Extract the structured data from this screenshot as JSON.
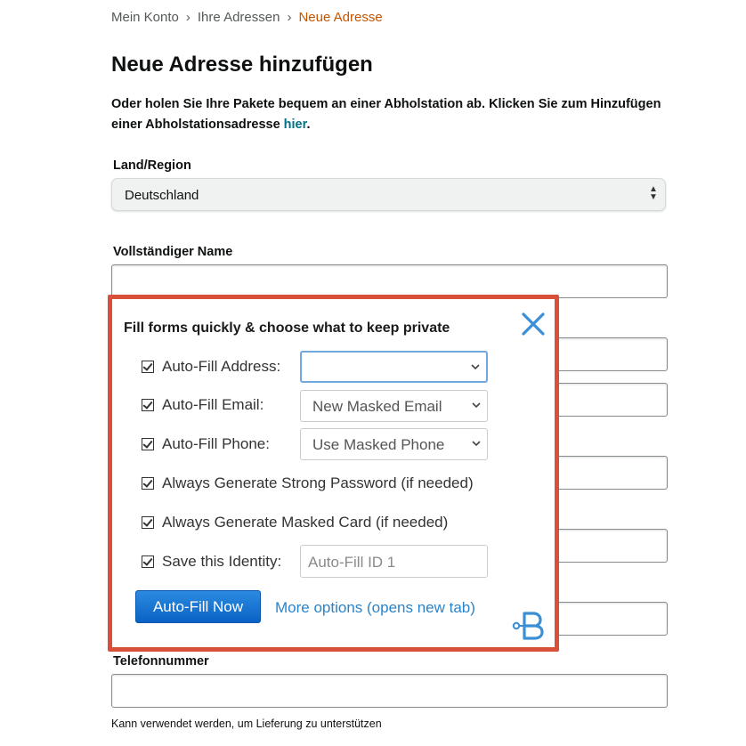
{
  "breadcrumb": {
    "items": [
      "Mein Konto",
      "Ihre Adressen"
    ],
    "current": "Neue Adresse",
    "separator": "›"
  },
  "page": {
    "title": "Neue Adresse hinzufügen",
    "intro_text": "Oder holen Sie Ihre Pakete bequem an einer Abholstation ab. Klicken Sie zum Hinzufügen einer Abholstationsadresse ",
    "intro_link": "hier",
    "intro_end": "."
  },
  "form": {
    "country_label": "Land/Region",
    "country_value": "Deutschland",
    "name_label": "Vollständiger Name",
    "phone_label": "Telefonnummer",
    "phone_hint": "Kann verwendet werden, um Lieferung zu unterstützen"
  },
  "popup": {
    "title": "Fill forms quickly & choose what to keep private",
    "rows": [
      {
        "label": "Auto-Fill Address:",
        "checked": true,
        "control_value": ""
      },
      {
        "label": "Auto-Fill Email:",
        "checked": true,
        "control_value": "New Masked Email"
      },
      {
        "label": "Auto-Fill Phone:",
        "checked": true,
        "control_value": "Use Masked Phone"
      },
      {
        "label": "Always Generate Strong Password (if needed)",
        "checked": true
      },
      {
        "label": "Always Generate Masked Card (if needed)",
        "checked": true
      },
      {
        "label": "Save this Identity:",
        "checked": true,
        "placeholder": "Auto-Fill ID 1"
      }
    ],
    "primary_button": "Auto-Fill Now",
    "more_link": "More options (opens new tab)",
    "icons": {
      "close": "close-icon",
      "logo": "blur-logo-icon"
    },
    "colors": {
      "border": "#d9503a",
      "accent": "#2a84c9"
    }
  }
}
